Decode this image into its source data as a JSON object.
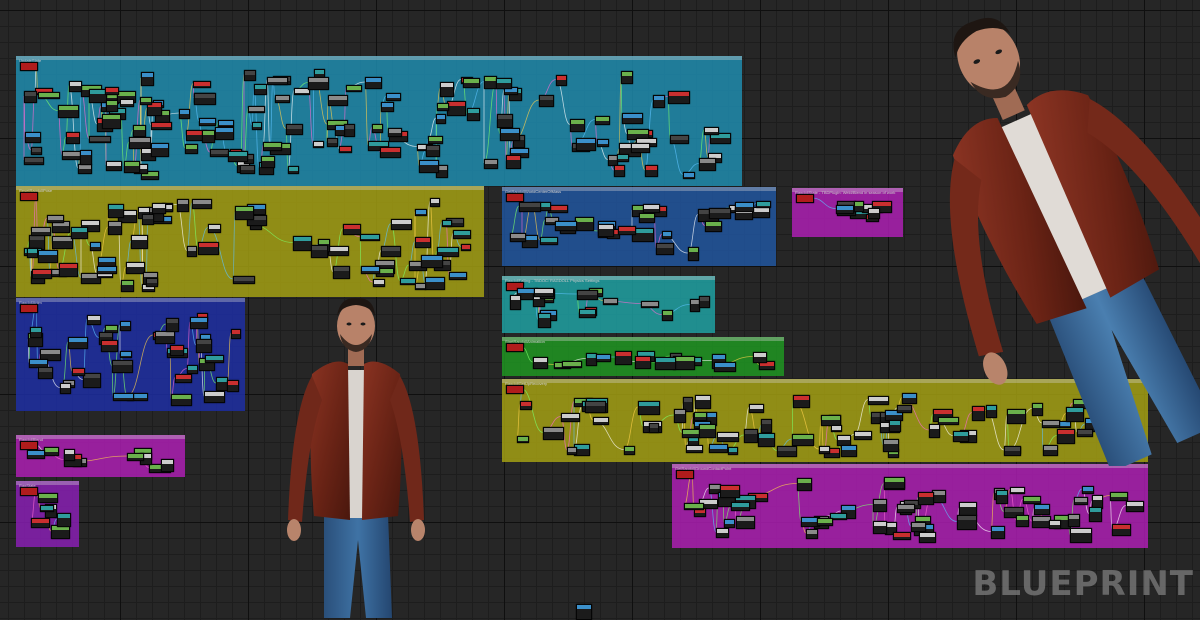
{
  "app": {
    "watermark": "BLUEPRINT"
  },
  "colors": {
    "cyan": "#1f8fb3",
    "olive": "#a8a413",
    "blue": "#2157a3",
    "navy": "#1e2fa8",
    "teal": "#1fa5a7",
    "green": "#1f9a22",
    "magenta": "#b21fb8",
    "purple": "#8c1fb8"
  },
  "comments": [
    {
      "id": "c1",
      "color": "cyan",
      "title": "UpdateState"
    },
    {
      "id": "c2",
      "color": "olive",
      "title": "ResetRagdollPose"
    },
    {
      "id": "c3",
      "color": "blue",
      "title": "GetRagdollWorldCenterOfMass"
    },
    {
      "id": "c4",
      "color": "magenta",
      "title": "RagdollState - TBDPlugin: Weld/Blend in season of work"
    },
    {
      "id": "c5",
      "color": "navy",
      "title": "RagdollAnim"
    },
    {
      "id": "c6",
      "color": "teal",
      "title": "RagdollFalling - TBDOC: RAGDOLL Physics Settings"
    },
    {
      "id": "c7",
      "color": "green",
      "title": "StartRagdollAnimation"
    },
    {
      "id": "c8",
      "color": "olive",
      "title": "RagdollGetUpRecovery"
    },
    {
      "id": "c9",
      "color": "magenta",
      "title": "RagdollBlend"
    },
    {
      "id": "c10",
      "color": "purple",
      "title": "RagState"
    },
    {
      "id": "c11",
      "color": "magenta",
      "title": "GetRagdollGroundContactPoint"
    }
  ]
}
